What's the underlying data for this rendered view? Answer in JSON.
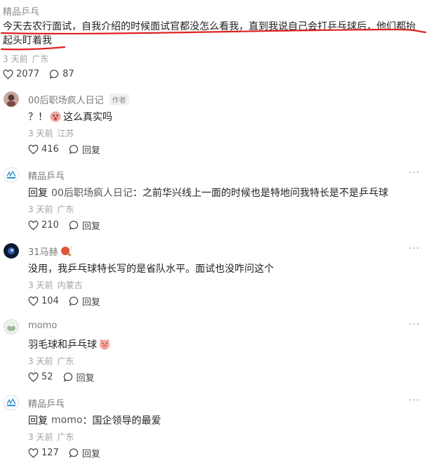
{
  "post": {
    "author": "精品乒乓",
    "text_line1": "今天去农行面试，自我介绍的时候面试官都没怎么看我，直到我说自己会打乒乓球后，他们都抬",
    "text_line2": "起头盯着我",
    "time": "3 天前",
    "location": "广东",
    "likes": "2077",
    "comments": "87",
    "underline_color": "#e02020"
  },
  "comments": [
    {
      "name": "00后职场疯人日记",
      "badge": "作者",
      "text": "？！",
      "text_after": "这么真实吗",
      "time": "3 天前",
      "location": "江苏",
      "likes": "416",
      "reply_label": "回复"
    },
    {
      "name": "精品乒乓",
      "reply_prefix": "回复",
      "mention": "00后职场疯人日记",
      "text": "：之前华兴线上一面的时候也是特地问我特长是不是乒乓球",
      "time": "3 天前",
      "location": "广东",
      "likes": "210",
      "reply_label": "回复"
    },
    {
      "name": "31马赫",
      "text": "没用，我乒乓球特长写的是省队水平。面试也没咋问这个",
      "time": "3 天前",
      "location": "内蒙古",
      "likes": "104",
      "reply_label": "回复"
    },
    {
      "name": "momo",
      "text": "羽毛球和乒乓球",
      "time": "3 天前",
      "location": "广东",
      "likes": "52",
      "reply_label": "回复"
    },
    {
      "name": "精品乒乓",
      "reply_prefix": "回复",
      "mention": "momo",
      "text": "：国企领导的最爱",
      "time": "3 天前",
      "location": "广东",
      "likes": "127",
      "reply_label": "回复"
    }
  ],
  "icons": {
    "like": "heart-outline-icon",
    "comment": "speech-bubble-icon",
    "more": "more-dots-icon"
  },
  "more_glyph": "···"
}
